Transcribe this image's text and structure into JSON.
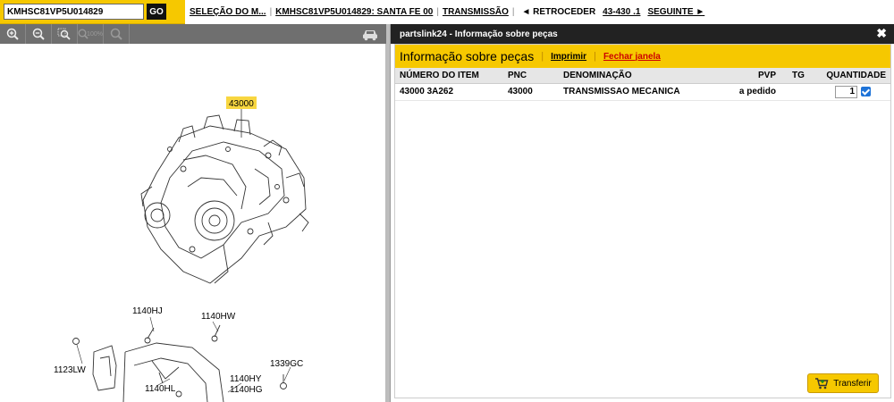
{
  "vin_search": {
    "value": "KMHSC81VP5U014829",
    "go_label": "GO"
  },
  "breadcrumb": {
    "item1": "SELEÇÃO DO M...",
    "item2": "KMHSC81VP5U014829: SANTA FE 00",
    "item3": "TRANSMISSÃO",
    "prev": "◄ RETROCEDER",
    "page": "43-430 .1",
    "next": "SEGUINTE ►"
  },
  "toolbar": {
    "zoom_pct": "100%"
  },
  "diagram": {
    "callouts": {
      "main": "43000",
      "c1": "1140HJ",
      "c2": "1140HW",
      "c3": "1123LW",
      "c4": "1339GC",
      "c5": "1140HY",
      "c6": "1140HG",
      "c7": "1140HL"
    }
  },
  "popup": {
    "window_title": "partslink24 - Informação sobre peças",
    "heading": "Informação sobre peças",
    "print_label": "Imprimir",
    "close_label": "Fechar janela",
    "columns": {
      "item_no": "NÚMERO DO ITEM",
      "pnc": "PNC",
      "name": "DENOMINAÇÃO",
      "pvp": "PVP",
      "tg": "TG",
      "qty": "QUANTIDADE"
    },
    "rows": [
      {
        "item_no": "43000 3A262",
        "pnc": "43000",
        "name": "TRANSMISSAO MECANICA",
        "pvp": "a pedido",
        "tg": "",
        "qty": "1"
      }
    ],
    "transfer_label": "Transferir"
  },
  "colors": {
    "accent": "#f6c800",
    "titlebar": "#222222",
    "toolbar": "#6f6f6f",
    "checkbox": "#1e73d8"
  }
}
